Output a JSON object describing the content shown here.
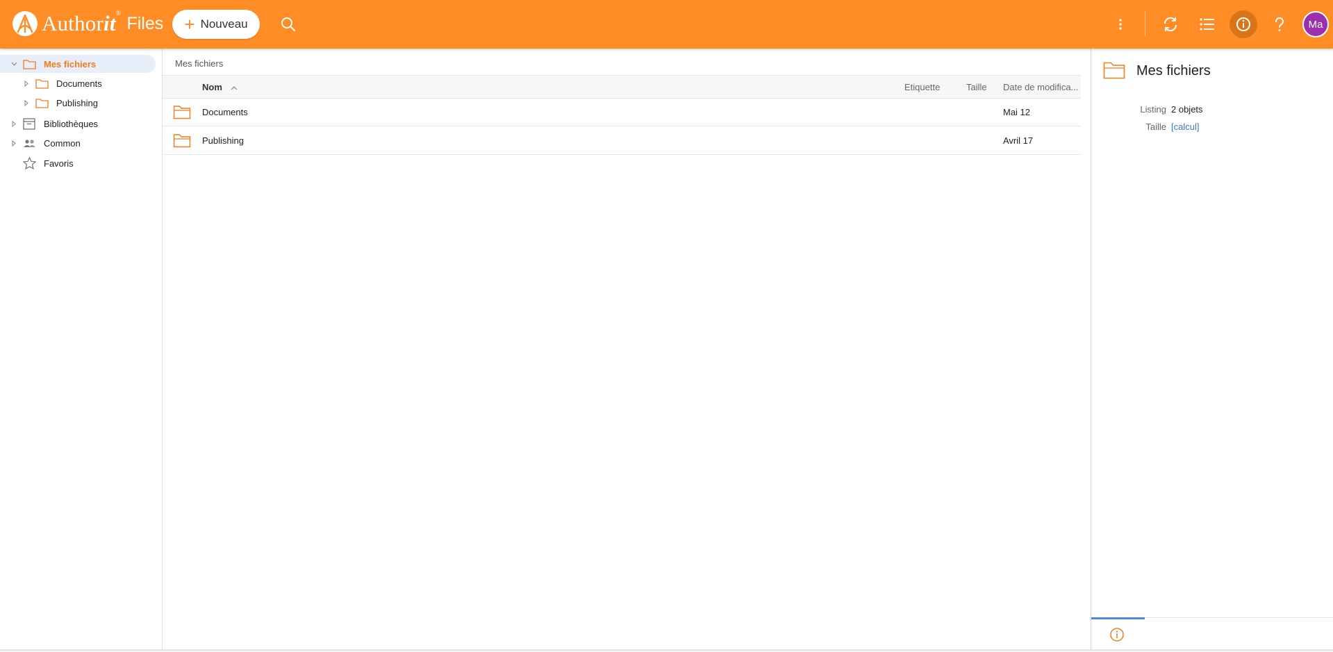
{
  "header": {
    "logo_word": "Author",
    "logo_italic": "it",
    "logo_reg": "®",
    "logo_suffix": "Files",
    "new_button_label": "Nouveau",
    "avatar_initials": "Ma",
    "accent_color": "#ff8c24"
  },
  "sidebar": {
    "items": [
      {
        "label": "Mes fichiers",
        "icon": "folder-icon",
        "selected": true
      },
      {
        "label": "Documents",
        "icon": "folder-icon"
      },
      {
        "label": "Publishing",
        "icon": "folder-icon"
      },
      {
        "label": "Bibliothèques",
        "icon": "archive-icon"
      },
      {
        "label": "Common",
        "icon": "group-icon"
      },
      {
        "label": "Favoris",
        "icon": "star-icon"
      }
    ]
  },
  "main": {
    "breadcrumb": "Mes fichiers",
    "columns": {
      "name": "Nom",
      "tag": "Etiquette",
      "size": "Taille",
      "date": "Date de modifica..."
    },
    "rows": [
      {
        "name": "Documents",
        "date": "Mai 12"
      },
      {
        "name": "Publishing",
        "date": "Avril 17"
      }
    ]
  },
  "info_panel": {
    "title": "Mes fichiers",
    "listing_label": "Listing",
    "listing_value": "2 objets",
    "size_label": "Taille",
    "size_value": "[calcul]"
  }
}
